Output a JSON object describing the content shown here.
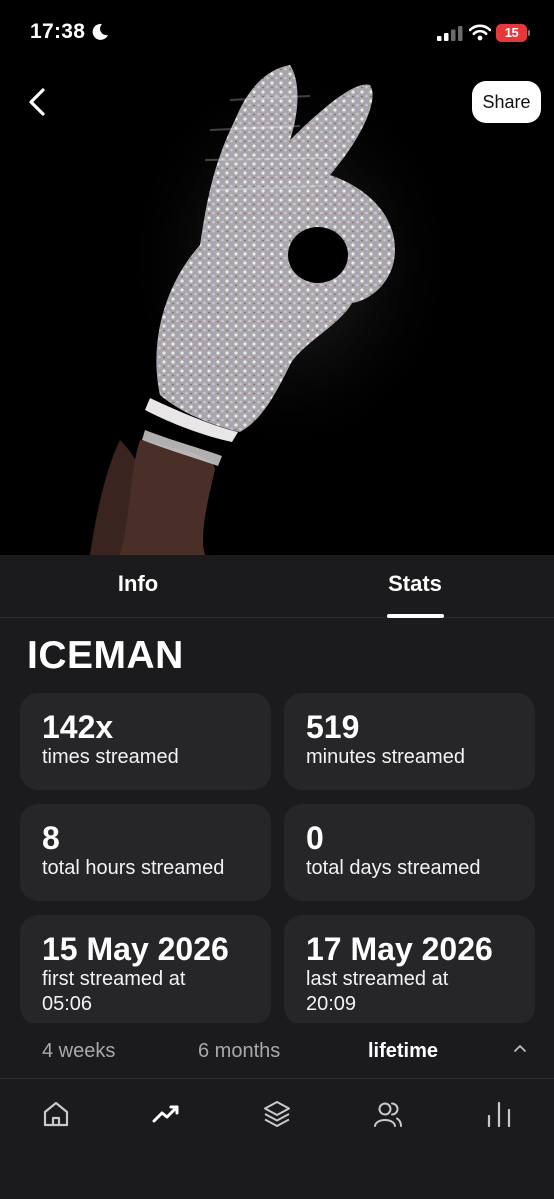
{
  "status_bar": {
    "time": "17:38",
    "battery_level": "15"
  },
  "header": {
    "share_label": "Share"
  },
  "tabs": [
    {
      "label": "Info",
      "selected": false
    },
    {
      "label": "Stats",
      "selected": true
    }
  ],
  "track": {
    "title": "ICEMAN"
  },
  "stats": [
    {
      "value": "142x",
      "label": "times streamed"
    },
    {
      "value": "519",
      "label": "minutes streamed"
    },
    {
      "value": "8",
      "label": "total hours streamed"
    },
    {
      "value": "0",
      "label": "total days streamed"
    },
    {
      "value": "15 May 2026",
      "label": "first streamed at",
      "sub": "05:06"
    },
    {
      "value": "17 May 2026",
      "label": "last streamed at",
      "sub": "20:09"
    }
  ],
  "periods": [
    {
      "label": "4 weeks",
      "selected": false
    },
    {
      "label": "6 months",
      "selected": false
    },
    {
      "label": "lifetime",
      "selected": true
    }
  ],
  "nav": [
    {
      "icon": "home-icon",
      "selected": false
    },
    {
      "icon": "trend-icon",
      "selected": true
    },
    {
      "icon": "layers-icon",
      "selected": false
    },
    {
      "icon": "friends-icon",
      "selected": false
    },
    {
      "icon": "bar-chart-icon",
      "selected": false
    }
  ],
  "colors": {
    "background": "#1b1b1d",
    "card": "#262629",
    "accent": "#ffffff",
    "muted_text": "#a8a8ab",
    "battery_low": "#e5383b"
  }
}
